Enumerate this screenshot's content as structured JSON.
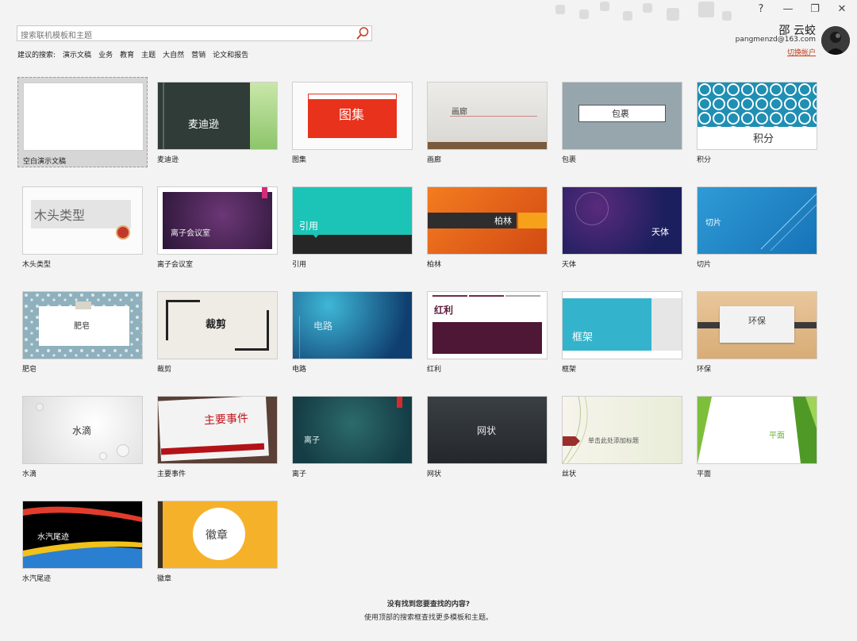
{
  "window": {
    "help": "?",
    "minimize": "—",
    "restore": "❐",
    "close": "✕"
  },
  "search": {
    "placeholder": "搜索联机模板和主题"
  },
  "suggestions": {
    "label": "建议的搜索:",
    "items": [
      "演示文稿",
      "业务",
      "教育",
      "主题",
      "大自然",
      "营销",
      "论文和报告"
    ]
  },
  "user": {
    "name": "邵 云蛟",
    "email": "pangmenzd@163.com",
    "switch_account": "切换帐户"
  },
  "templates": [
    {
      "label": "空白演示文稿",
      "thumb_text": ""
    },
    {
      "label": "麦迪逊",
      "thumb_text": "麦迪逊"
    },
    {
      "label": "图集",
      "thumb_text": "图集"
    },
    {
      "label": "画廊",
      "thumb_text": "画廊"
    },
    {
      "label": "包裹",
      "thumb_text": "包裹"
    },
    {
      "label": "积分",
      "thumb_text": "积分"
    },
    {
      "label": "木头类型",
      "thumb_text": "木头类型"
    },
    {
      "label": "离子会议室",
      "thumb_text": "离子会议室"
    },
    {
      "label": "引用",
      "thumb_text": "引用"
    },
    {
      "label": "柏林",
      "thumb_text": "柏林"
    },
    {
      "label": "天体",
      "thumb_text": "天体"
    },
    {
      "label": "切片",
      "thumb_text": "切片"
    },
    {
      "label": "肥皂",
      "thumb_text": "肥皂"
    },
    {
      "label": "裁剪",
      "thumb_text": "裁剪"
    },
    {
      "label": "电路",
      "thumb_text": "电路"
    },
    {
      "label": "红利",
      "thumb_text": "红利"
    },
    {
      "label": "框架",
      "thumb_text": "框架"
    },
    {
      "label": "环保",
      "thumb_text": "环保"
    },
    {
      "label": "水滴",
      "thumb_text": "水滴"
    },
    {
      "label": "主要事件",
      "thumb_text": "主要事件"
    },
    {
      "label": "离子",
      "thumb_text": "离子"
    },
    {
      "label": "网状",
      "thumb_text": "网状"
    },
    {
      "label": "丝状",
      "thumb_text": "单击此处添加标题"
    },
    {
      "label": "平面",
      "thumb_text": "平面"
    },
    {
      "label": "水汽尾迹",
      "thumb_text": "水汽尾迹"
    },
    {
      "label": "徽章",
      "thumb_text": "徽章"
    }
  ],
  "footer": {
    "title": "没有找到您要查找的内容?",
    "hint": "使用顶部的搜索框查找更多模板和主题。"
  },
  "colors": {
    "accent": "#c43e1c",
    "background": "#f3f3f3"
  }
}
